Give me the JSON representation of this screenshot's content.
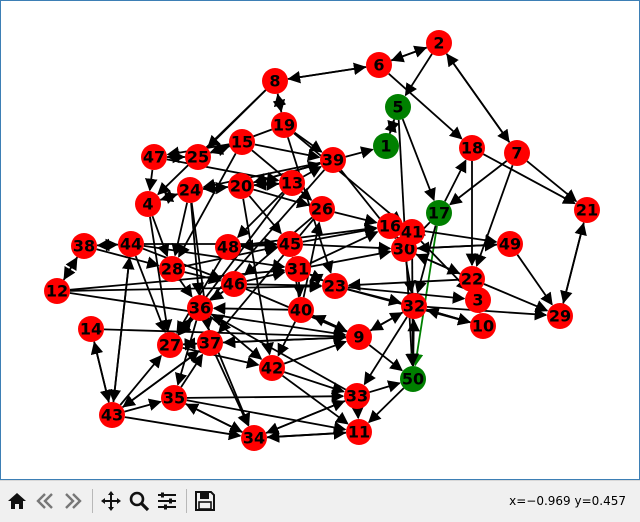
{
  "colors": {
    "node_default": "#ff0000",
    "node_highlight": "#008000",
    "edge_default": "#000000",
    "edge_highlight": "#008000",
    "toolbar_bg": "#f0f0f0"
  },
  "graph": {
    "highlighted_nodes": [
      "1",
      "5",
      "17",
      "50"
    ],
    "highlighted_edges": [
      [
        "17",
        "50"
      ]
    ],
    "nodes": [
      "1",
      "2",
      "3",
      "4",
      "5",
      "6",
      "7",
      "8",
      "9",
      "10",
      "11",
      "12",
      "13",
      "14",
      "15",
      "16",
      "17",
      "18",
      "19",
      "20",
      "21",
      "22",
      "23",
      "24",
      "25",
      "26",
      "27",
      "28",
      "29",
      "30",
      "31",
      "32",
      "33",
      "34",
      "35",
      "36",
      "37",
      "38",
      "39",
      "40",
      "41",
      "42",
      "43",
      "44",
      "45",
      "46",
      "47",
      "48",
      "49",
      "50"
    ],
    "edges": [
      [
        "6",
        "2"
      ],
      [
        "2",
        "6"
      ],
      [
        "6",
        "8"
      ],
      [
        "8",
        "6"
      ],
      [
        "2",
        "7"
      ],
      [
        "7",
        "2"
      ],
      [
        "2",
        "5"
      ],
      [
        "6",
        "18"
      ],
      [
        "18",
        "21"
      ],
      [
        "7",
        "21"
      ],
      [
        "21",
        "29"
      ],
      [
        "29",
        "21"
      ],
      [
        "1",
        "5"
      ],
      [
        "5",
        "1"
      ],
      [
        "5",
        "17"
      ],
      [
        "5",
        "50"
      ],
      [
        "39",
        "1"
      ],
      [
        "17",
        "50"
      ],
      [
        "17",
        "30"
      ],
      [
        "17",
        "32"
      ],
      [
        "17",
        "18"
      ],
      [
        "7",
        "17"
      ],
      [
        "7",
        "22"
      ],
      [
        "8",
        "19"
      ],
      [
        "19",
        "8"
      ],
      [
        "8",
        "25"
      ],
      [
        "8",
        "4"
      ],
      [
        "19",
        "25"
      ],
      [
        "19",
        "39"
      ],
      [
        "19",
        "23"
      ],
      [
        "25",
        "15"
      ],
      [
        "15",
        "25"
      ],
      [
        "47",
        "25"
      ],
      [
        "25",
        "47"
      ],
      [
        "15",
        "47"
      ],
      [
        "15",
        "39"
      ],
      [
        "39",
        "20"
      ],
      [
        "20",
        "39"
      ],
      [
        "39",
        "24"
      ],
      [
        "15",
        "26"
      ],
      [
        "15",
        "28"
      ],
      [
        "24",
        "20"
      ],
      [
        "20",
        "24"
      ],
      [
        "24",
        "4"
      ],
      [
        "4",
        "24"
      ],
      [
        "20",
        "13"
      ],
      [
        "13",
        "20"
      ],
      [
        "13",
        "39"
      ],
      [
        "20",
        "45"
      ],
      [
        "20",
        "26"
      ],
      [
        "24",
        "36"
      ],
      [
        "24",
        "28"
      ],
      [
        "24",
        "37"
      ],
      [
        "13",
        "27"
      ],
      [
        "13",
        "48"
      ],
      [
        "26",
        "16"
      ],
      [
        "26",
        "46"
      ],
      [
        "16",
        "41"
      ],
      [
        "41",
        "16"
      ],
      [
        "16",
        "49"
      ],
      [
        "16",
        "30"
      ],
      [
        "30",
        "49"
      ],
      [
        "49",
        "30"
      ],
      [
        "30",
        "22"
      ],
      [
        "22",
        "30"
      ],
      [
        "30",
        "32"
      ],
      [
        "41",
        "3"
      ],
      [
        "22",
        "10"
      ],
      [
        "22",
        "29"
      ],
      [
        "22",
        "23"
      ],
      [
        "49",
        "29"
      ],
      [
        "32",
        "10"
      ],
      [
        "10",
        "32"
      ],
      [
        "32",
        "29"
      ],
      [
        "32",
        "33"
      ],
      [
        "32",
        "9"
      ],
      [
        "50",
        "32"
      ],
      [
        "33",
        "50"
      ],
      [
        "50",
        "11"
      ],
      [
        "33",
        "11"
      ],
      [
        "11",
        "34"
      ],
      [
        "34",
        "11"
      ],
      [
        "33",
        "34"
      ],
      [
        "34",
        "33"
      ],
      [
        "35",
        "33"
      ],
      [
        "35",
        "11"
      ],
      [
        "34",
        "35"
      ],
      [
        "35",
        "34"
      ],
      [
        "43",
        "34"
      ],
      [
        "43",
        "35"
      ],
      [
        "43",
        "14"
      ],
      [
        "14",
        "43"
      ],
      [
        "43",
        "44"
      ],
      [
        "44",
        "43"
      ],
      [
        "43",
        "27"
      ],
      [
        "43",
        "37"
      ],
      [
        "37",
        "43"
      ],
      [
        "14",
        "9"
      ],
      [
        "12",
        "38"
      ],
      [
        "38",
        "12"
      ],
      [
        "38",
        "44"
      ],
      [
        "44",
        "38"
      ],
      [
        "38",
        "28"
      ],
      [
        "44",
        "45"
      ],
      [
        "44",
        "46"
      ],
      [
        "44",
        "31"
      ],
      [
        "12",
        "23"
      ],
      [
        "12",
        "31"
      ],
      [
        "28",
        "45"
      ],
      [
        "28",
        "46"
      ],
      [
        "48",
        "45"
      ],
      [
        "45",
        "48"
      ],
      [
        "45",
        "16"
      ],
      [
        "48",
        "16"
      ],
      [
        "46",
        "23"
      ],
      [
        "46",
        "31"
      ],
      [
        "31",
        "23"
      ],
      [
        "23",
        "31"
      ],
      [
        "31",
        "16"
      ],
      [
        "31",
        "40"
      ],
      [
        "40",
        "9"
      ],
      [
        "9",
        "40"
      ],
      [
        "40",
        "36"
      ],
      [
        "40",
        "42"
      ],
      [
        "40",
        "45"
      ],
      [
        "36",
        "27"
      ],
      [
        "27",
        "36"
      ],
      [
        "27",
        "37"
      ],
      [
        "37",
        "27"
      ],
      [
        "37",
        "9"
      ],
      [
        "9",
        "37"
      ],
      [
        "27",
        "42"
      ],
      [
        "36",
        "42"
      ],
      [
        "42",
        "9"
      ],
      [
        "37",
        "34"
      ],
      [
        "36",
        "34"
      ],
      [
        "9",
        "50"
      ],
      [
        "9",
        "32"
      ],
      [
        "23",
        "10"
      ],
      [
        "23",
        "3"
      ],
      [
        "23",
        "32"
      ],
      [
        "28",
        "36"
      ],
      [
        "46",
        "36"
      ],
      [
        "48",
        "27"
      ],
      [
        "26",
        "37"
      ],
      [
        "39",
        "27"
      ],
      [
        "39",
        "30"
      ],
      [
        "4",
        "28"
      ],
      [
        "4",
        "27"
      ],
      [
        "47",
        "4"
      ],
      [
        "45",
        "30"
      ],
      [
        "31",
        "30"
      ],
      [
        "40",
        "26"
      ],
      [
        "18",
        "22"
      ],
      [
        "19",
        "41"
      ],
      [
        "41",
        "50"
      ],
      [
        "33",
        "36"
      ],
      [
        "42",
        "33"
      ],
      [
        "42",
        "11"
      ],
      [
        "35",
        "37"
      ],
      [
        "36",
        "35"
      ],
      [
        "46",
        "9"
      ],
      [
        "12",
        "9"
      ],
      [
        "44",
        "27"
      ],
      [
        "47",
        "13"
      ],
      [
        "20",
        "42"
      ]
    ]
  },
  "toolbar": {
    "icons": [
      "home-icon",
      "back-icon",
      "forward-icon",
      "pan-icon",
      "zoom-icon",
      "configure-subplots-icon",
      "save-icon"
    ],
    "coordinates": "x=−0.969 y=0.457"
  }
}
